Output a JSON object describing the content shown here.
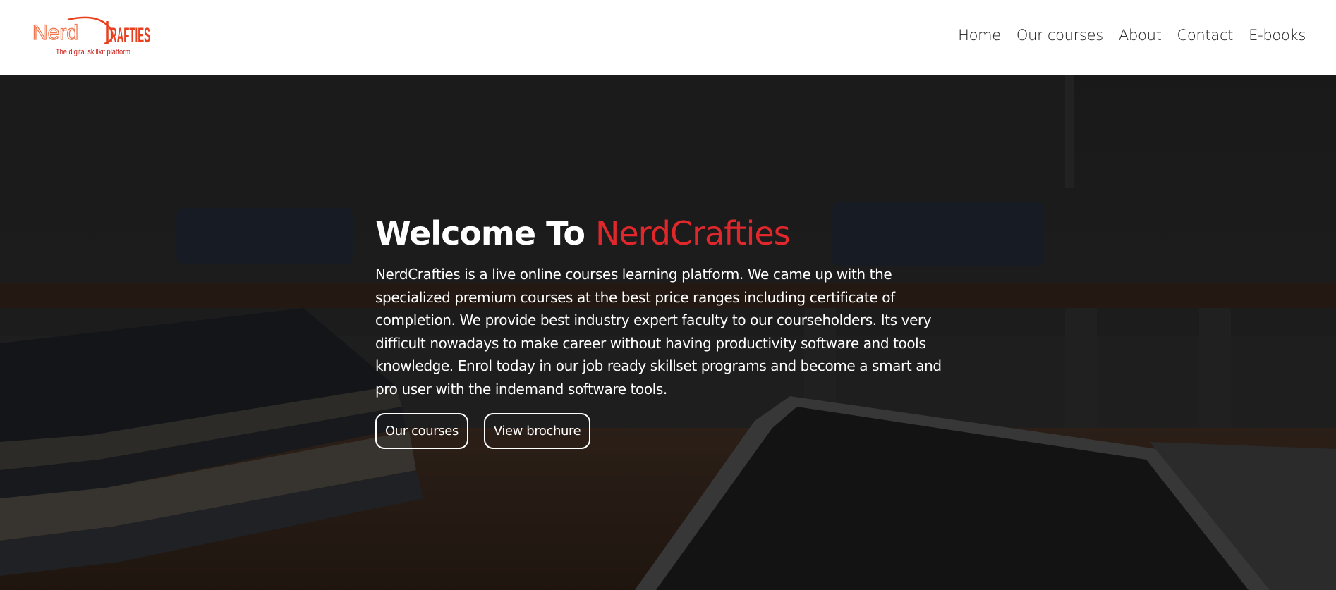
{
  "brand": {
    "logo_text_part1": "Nerd",
    "logo_text_part2": "RAFTIES",
    "logo_tagline": "The digital skillkit platform",
    "color": "#e0282c"
  },
  "nav": {
    "items": [
      {
        "label": "Home"
      },
      {
        "label": "Our courses"
      },
      {
        "label": "About"
      },
      {
        "label": "Contact"
      },
      {
        "label": "E-books"
      }
    ]
  },
  "hero": {
    "title_prefix": "Welcome To ",
    "title_brand": "NerdCrafties",
    "description": "NerdCrafties is a live online courses learning platform. We came up with the specialized premium courses at the best price ranges including certificate of completion. We provide best industry expert faculty to our courseholders. Its very difficult nowadays to make career without having productivity software and tools knowledge. Enrol today in our job ready skillset programs and become a smart and pro user with the indemand software tools.",
    "buttons": {
      "primary_label": "Our courses",
      "secondary_label": "View brochure"
    }
  },
  "colors": {
    "accent": "#e0282c",
    "header_bg": "#ffffff",
    "hero_overlay": "#1c1c1c"
  }
}
